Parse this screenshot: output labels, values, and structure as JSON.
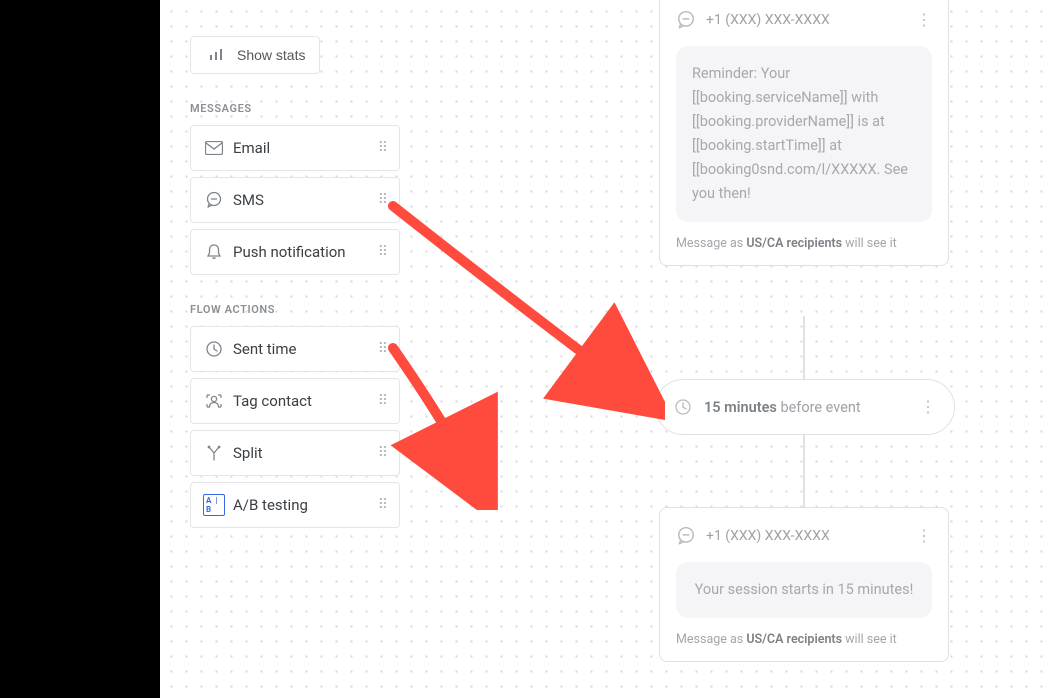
{
  "toolbar": {
    "show_stats": "Show stats"
  },
  "sections": {
    "messages_label": "MESSAGES",
    "messages": {
      "email": "Email",
      "sms": "SMS",
      "push": "Push notification"
    },
    "flow_label": "FLOW ACTIONS",
    "flow": {
      "sent_time": "Sent time",
      "tag_contact": "Tag contact",
      "split": "Split",
      "ab_testing": "A/B testing"
    }
  },
  "canvas": {
    "card1": {
      "phone": "+1 (XXX) XXX-XXXX",
      "body": "Reminder: Your [[booking.serviceName]] with [[booking.providerName]] is at [[booking.startTime]] at [[booking0snd.com/l/XXXXX. See you then!",
      "note_prefix": "Message as ",
      "note_bold": "US/CA recipients",
      "note_suffix": " will see it"
    },
    "timing": {
      "duration": "15 minutes",
      "suffix": " before event"
    },
    "card2": {
      "phone": "+1 (XXX) XXX-XXXX",
      "body": "Your session starts in 15 minutes!",
      "note_prefix": "Message as ",
      "note_bold": "US/CA recipients",
      "note_suffix": " will see it"
    }
  },
  "ab_badge": "A | B"
}
